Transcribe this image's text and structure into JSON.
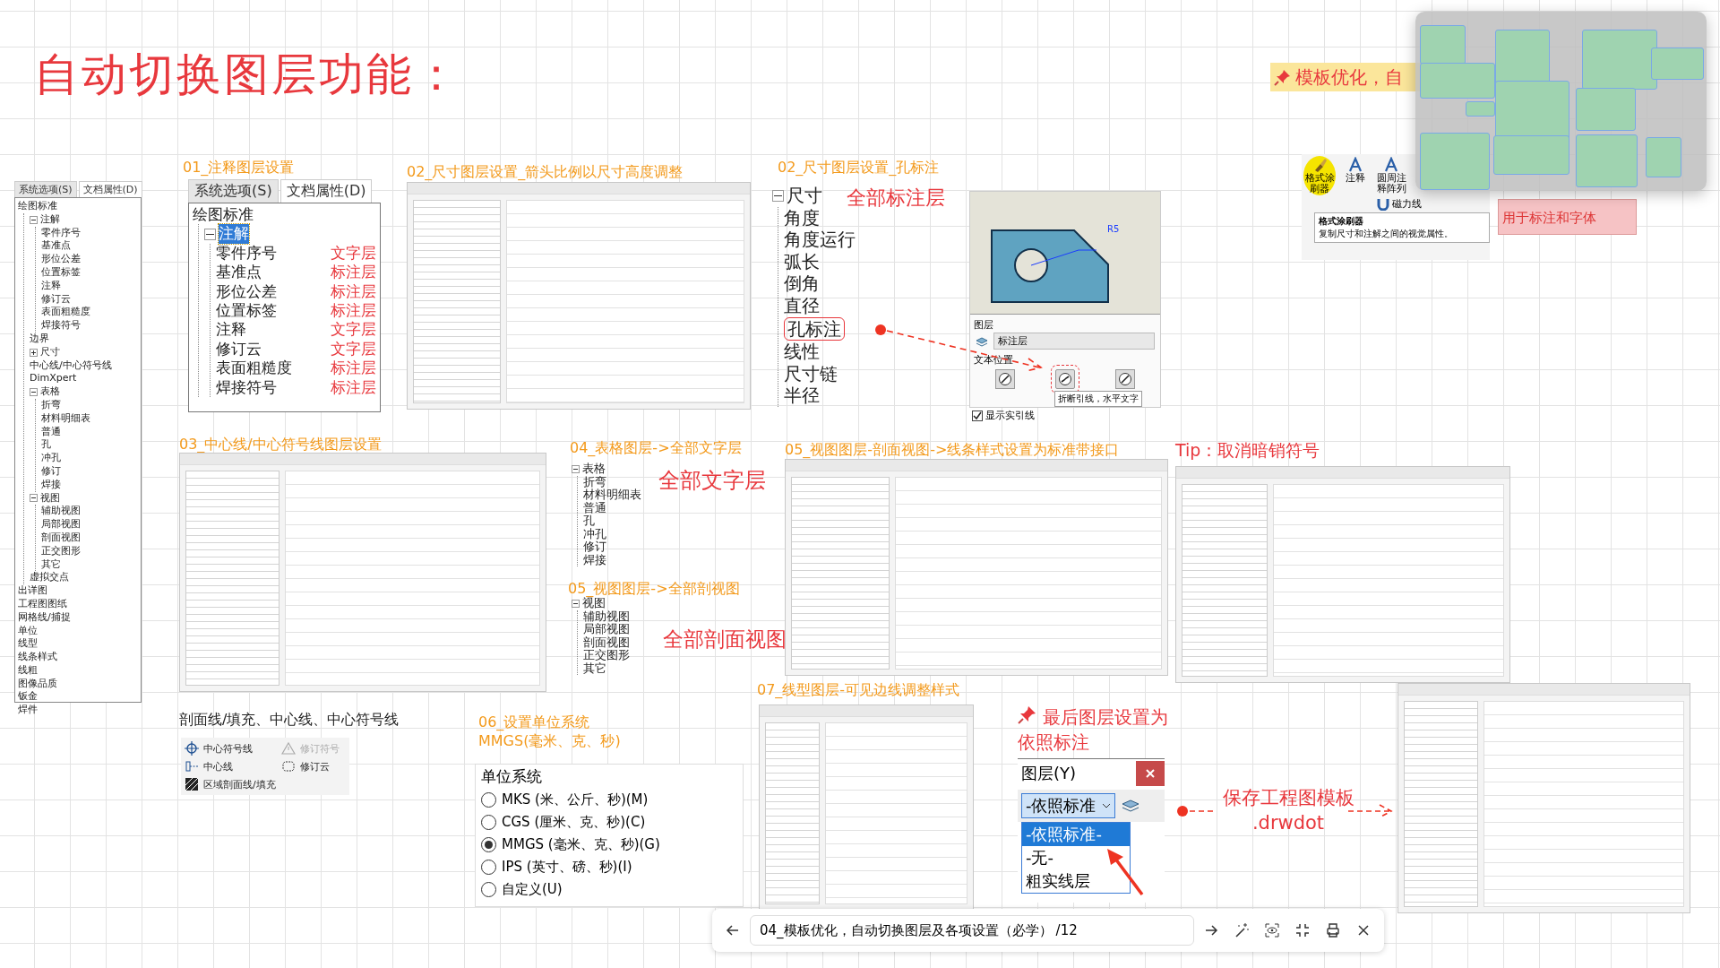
{
  "title": "自动切换图层功能：",
  "nav_tree": {
    "tabs": [
      {
        "label": "系统选项(S)",
        "selected": false
      },
      {
        "label": "文档属性(D)",
        "selected": true
      }
    ],
    "items": [
      {
        "label": "绘图标准",
        "children": [
          {
            "label": "注解",
            "expanded": true,
            "children": [
              {
                "label": "零件序号"
              },
              {
                "label": "基准点"
              },
              {
                "label": "形位公差"
              },
              {
                "label": "位置标签"
              },
              {
                "label": "注释"
              },
              {
                "label": "修订云"
              },
              {
                "label": "表面粗糙度"
              },
              {
                "label": "焊接符号"
              }
            ]
          },
          {
            "label": "边界"
          },
          {
            "label": "尺寸",
            "expanded": false
          },
          {
            "label": "中心线/中心符号线"
          },
          {
            "label": "DimXpert"
          },
          {
            "label": "表格",
            "expanded": true,
            "children": [
              {
                "label": "折弯"
              },
              {
                "label": "材料明细表"
              },
              {
                "label": "普通"
              },
              {
                "label": "孔"
              },
              {
                "label": "冲孔"
              },
              {
                "label": "修订"
              },
              {
                "label": "焊接"
              }
            ]
          },
          {
            "label": "视图",
            "expanded": true,
            "children": [
              {
                "label": "辅助视图"
              },
              {
                "label": "局部视图"
              },
              {
                "label": "剖面视图"
              },
              {
                "label": "正交图形"
              },
              {
                "label": "其它"
              }
            ]
          },
          {
            "label": "虚拟交点"
          }
        ]
      },
      {
        "label": "出详图"
      },
      {
        "label": "工程图图纸"
      },
      {
        "label": "网格线/捕捉"
      },
      {
        "label": "单位"
      },
      {
        "label": "线型"
      },
      {
        "label": "线条样式"
      },
      {
        "label": "线粗"
      },
      {
        "label": "图像品质"
      },
      {
        "label": "钣金"
      },
      {
        "label": "焊件"
      }
    ]
  },
  "section_01": {
    "heading": "01_注释图层设置",
    "tabs": [
      {
        "label": "系统选项(S)",
        "selected": false
      },
      {
        "label": "文档属性(D)",
        "selected": true
      }
    ],
    "tree": [
      {
        "label": "绘图标准",
        "selected": false,
        "children": [
          {
            "label": "注解",
            "selected": true,
            "expanded": true,
            "children": [
              {
                "label": "零件序号",
                "layer": "文字层",
                "selected": false
              },
              {
                "label": "基准点",
                "layer": "标注层",
                "selected": false
              },
              {
                "label": "形位公差",
                "layer": "标注层",
                "selected": false
              },
              {
                "label": "位置标签",
                "layer": "标注层",
                "selected": false
              },
              {
                "label": "注释",
                "layer": "文字层",
                "selected": false
              },
              {
                "label": "修订云",
                "layer": "文字层",
                "selected": false
              },
              {
                "label": "表面粗糙度",
                "layer": "标注层",
                "selected": false
              },
              {
                "label": "焊接符号",
                "layer": "标注层",
                "selected": false
              }
            ]
          }
        ]
      }
    ]
  },
  "section_02_arrows": {
    "heading": "02_尺寸图层设置_箭头比例以尺寸高度调整"
  },
  "section_02_hole": {
    "heading": "02_尺寸图层设置_孔标注",
    "note": "全部标注层",
    "tree": [
      {
        "label": "尺寸",
        "expanded": true,
        "children": [
          {
            "label": "角度",
            "circled": false
          },
          {
            "label": "角度运行",
            "circled": false
          },
          {
            "label": "弧长",
            "circled": false
          },
          {
            "label": "倒角",
            "circled": false
          },
          {
            "label": "直径",
            "circled": false
          },
          {
            "label": "孔标注",
            "circled": true
          },
          {
            "label": "线性",
            "circled": false
          },
          {
            "label": "尺寸链",
            "circled": false
          },
          {
            "label": "半径",
            "circled": false
          }
        ]
      }
    ],
    "dimension_text": "R5",
    "layer_label": "图层",
    "layer_value": "标注层",
    "text_position_label": "文本位置",
    "tooltip": "折断引线，水平文字",
    "leader_checkbox": {
      "label": "显示实引线",
      "checked": true
    }
  },
  "section_03": {
    "heading": "03_中心线/中心符号线图层设置"
  },
  "section_04": {
    "heading": "04_表格图层->全部文字层",
    "note": "全部文字层",
    "tree": [
      {
        "label": "表格",
        "expanded": true,
        "children": [
          {
            "label": "折弯"
          },
          {
            "label": "材料明细表"
          },
          {
            "label": "普通"
          },
          {
            "label": "孔"
          },
          {
            "label": "冲孔"
          },
          {
            "label": "修订"
          },
          {
            "label": "焊接"
          }
        ]
      }
    ]
  },
  "section_05_views": {
    "heading": "05_视图图层->全部剖视图",
    "note": "全部剖面视图",
    "tree": [
      {
        "label": "视图",
        "expanded": true,
        "children": [
          {
            "label": "辅助视图"
          },
          {
            "label": "局部视图"
          },
          {
            "label": "剖面视图"
          },
          {
            "label": "正交图形"
          },
          {
            "label": "其它"
          }
        ]
      }
    ]
  },
  "section_05_section": {
    "heading": "05_视图图层-剖面视图->线条样式设置为标准带接口"
  },
  "section_tip": {
    "heading": "Tip：取消暗销符号"
  },
  "annotation_panel": {
    "caption": "剖面线/填充、中心线、中心符号线",
    "items": [
      {
        "kind": "center-mark",
        "label": "中心符号线",
        "disabled": false
      },
      {
        "kind": "revision-symbol",
        "label": "修订符号",
        "disabled": true
      },
      {
        "kind": "centerline",
        "label": "中心线",
        "disabled": false
      },
      {
        "kind": "revision-cloud",
        "label": "修订云",
        "disabled": false
      },
      {
        "kind": "hatch",
        "label": "区域剖面线/填充",
        "disabled": false
      }
    ]
  },
  "section_06": {
    "heading": [
      "06_设置单位系统",
      "MMGS(毫米、克、秒)"
    ],
    "group_label": "单位系统",
    "options": [
      {
        "label": "MKS (米、公斤、秒)(M)",
        "selected": false
      },
      {
        "label": "CGS (厘米、克、秒)(C)",
        "selected": false
      },
      {
        "label": "MMGS (毫米、克、秒)(G)",
        "selected": true
      },
      {
        "label": "IPS (英寸、磅、秒)(I)",
        "selected": false
      },
      {
        "label": "自定义(U)",
        "selected": false
      }
    ]
  },
  "section_07": {
    "heading": "07_线型图层-可见边线调整样式"
  },
  "final_note": [
    "最后图层设置为",
    "依照标注"
  ],
  "layer_panel": {
    "title": "图层(Y)",
    "value": "-依照标准",
    "options": [
      {
        "label": "-依照标准-",
        "selected": true
      },
      {
        "label": "-无-",
        "selected": false
      },
      {
        "label": "粗实线层",
        "selected": false
      }
    ]
  },
  "save_note": [
    "保存工程图模板",
    ".drwdot"
  ],
  "pinned_banner": "模板优化，自",
  "ribbon": {
    "buttons": [
      {
        "label": "格式涂刷器",
        "highlighted": true
      },
      {
        "label": "注释",
        "highlighted": false
      },
      {
        "label": "圆周注释阵列",
        "highlighted": false
      }
    ],
    "side_button": "磁力线",
    "tooltip_title": "格式涂刷器",
    "tooltip_text": "复制尺寸和注解之间的视觉属性。"
  },
  "tip_note": "用于标注和字体",
  "toolbar": {
    "title": "04_模板优化，自动切换图层及各项设置（必学）",
    "page": "/12"
  }
}
